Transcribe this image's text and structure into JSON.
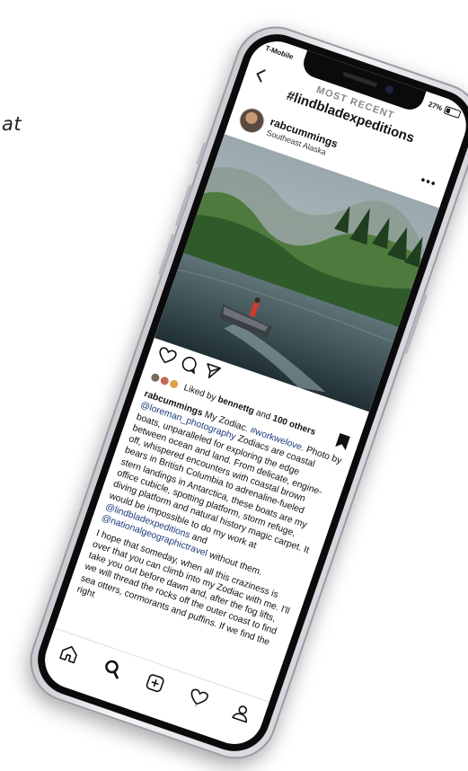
{
  "page_text": "at",
  "status_bar": {
    "carrier": "T-Mobile",
    "battery": "27%"
  },
  "header": {
    "back_icon": "chevron-left-icon",
    "subtitle": "MOST RECENT",
    "title": "#lindbladexpeditions"
  },
  "post": {
    "username": "rabcummings",
    "location": "Southeast Alaska",
    "more_icon": "more-icon",
    "actions": [
      "heart-icon",
      "comment-icon",
      "share-icon",
      "bookmark-icon"
    ],
    "likes": {
      "prefix": "Liked by",
      "user": "bennettg",
      "middle": "and",
      "count_text": "100 others"
    },
    "caption": {
      "username": "rabcummings",
      "text1": "My Zodiac.",
      "hashtag": "#workwelove",
      "text2": ". Photo by",
      "mention1": "@loreman_photography",
      "para1": "Zodiacs are coastal boats, unparalleled for exploring the edge between ocean and land. From delicate, engine-off, whispered encounters with coastal brown bears in British Columbia to adrenaline-fueled stern landings in Antarctica, these boats are my office cubicle, spotting platform, storm refuge, diving platform and natural history magic carpet. It would be impossible to do my work at",
      "mention2": "@lindbladexpeditions",
      "and_text": "and",
      "mention3": "@nationalgeographictravel",
      "para1_end": "without them.",
      "para2": "I hope that someday, when all this craziness is over that you can climb into my Zodiac with me. I'll take you out before dawn and, after the fog lifts, we will thread the rocks off the outer coast to find sea otters, cormorants and puffins. If we find the right"
    }
  },
  "tab_bar": [
    "home-icon",
    "search-icon",
    "new-post-icon",
    "activity-icon",
    "profile-icon"
  ]
}
